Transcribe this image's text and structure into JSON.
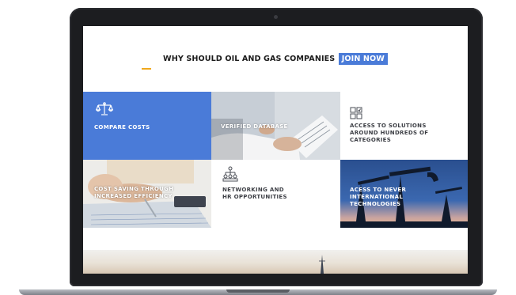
{
  "header": {
    "title": "WHY SHOULD OIL AND GAS COMPANIES",
    "highlight": "JOIN NOW"
  },
  "tiles": [
    {
      "label": "COMPARE COSTS",
      "icon": "scales-icon"
    },
    {
      "label": "VERIFIED DATABASE"
    },
    {
      "label": "ACCESS TO SOLUTIONS\nAROUND HUNDREDS OF\nCATEGORIES",
      "icon": "categories-grid-icon"
    },
    {
      "label": "COST SAVING THROUGH\nINCREASED EFFICIENCY"
    },
    {
      "label": "NETWORKING AND\nHR OPPORTUNITIES",
      "icon": "network-icon"
    },
    {
      "label": "ACESS TO NEVER\nINTERNATIONAL\nTECHNOLOGIES"
    }
  ],
  "colors": {
    "accent_blue": "#4a7bd8",
    "accent_orange": "#f0a81c",
    "laptop_bezel": "#1c1d20"
  }
}
